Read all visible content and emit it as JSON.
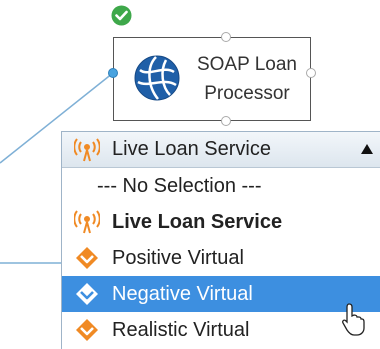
{
  "node": {
    "title_line1": "SOAP Loan",
    "title_line2": "Processor",
    "status_icon": "check-circle-icon",
    "service_icon": "globe-icon"
  },
  "dropdown": {
    "selected_label": "Live Loan Service",
    "options": [
      {
        "label": "--- No Selection ---",
        "icon": ""
      },
      {
        "label": "Live Loan Service",
        "icon": "antenna-icon"
      },
      {
        "label": "Positive Virtual",
        "icon": "virtual-icon"
      },
      {
        "label": "Negative Virtual",
        "icon": "virtual-icon"
      },
      {
        "label": "Realistic Virtual",
        "icon": "virtual-icon"
      }
    ],
    "highlighted": "Negative Virtual"
  },
  "colors": {
    "highlight": "#3d8fe0",
    "virtual_icon": "#f08a24",
    "live_icon": "#f08a24",
    "status_ok": "#3ea84a",
    "connector": "#7fb0d6"
  }
}
